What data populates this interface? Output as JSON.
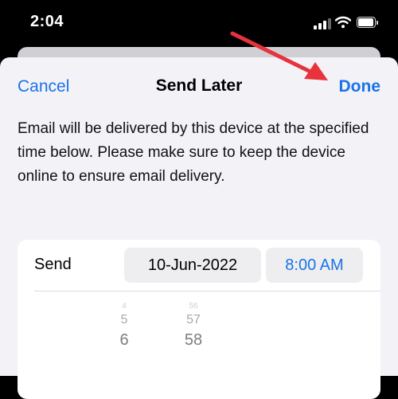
{
  "status_bar": {
    "time": "2:04"
  },
  "nav": {
    "cancel_label": "Cancel",
    "title": "Send Later",
    "done_label": "Done"
  },
  "description": "Email will be delivered by this device at the specified time below. Please make sure to keep the device online to ensure email delivery.",
  "schedule": {
    "send_label": "Send",
    "date_value": "10-Jun-2022",
    "time_value": "8:00 AM"
  },
  "picker": {
    "hour_rows": [
      "4",
      "5",
      "6"
    ],
    "minute_rows": [
      "56",
      "57",
      "58"
    ]
  },
  "colors": {
    "accent": "#1a73e8",
    "annotation_arrow": "#e8323c",
    "sheet_bg": "#f2f2f7"
  },
  "icons": [
    "signal-icon",
    "wifi-icon",
    "battery-icon",
    "annotation-arrow"
  ]
}
